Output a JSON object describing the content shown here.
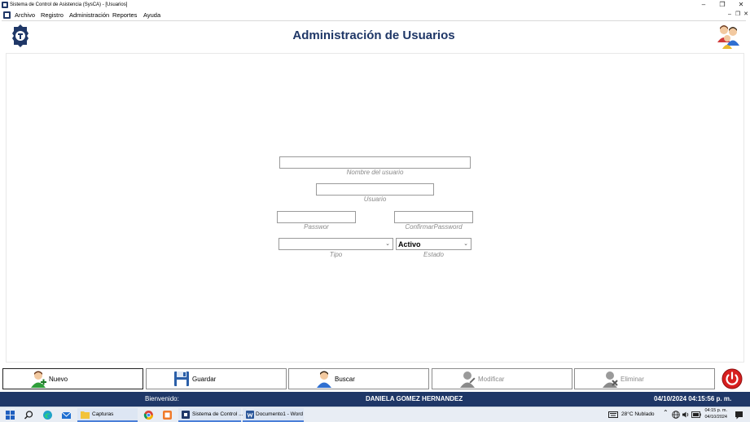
{
  "window": {
    "title": "Sistema de Control de Asistencia (SysCA) - [Usuarios]",
    "controls": {
      "minimize": "–",
      "restore": "❐",
      "close": "✕"
    },
    "mdi_controls": {
      "minimize": "–",
      "restore": "❐",
      "close": "✕"
    }
  },
  "menu": [
    "Archivo",
    "Registro",
    "Administración",
    "Reportes",
    "Ayuda"
  ],
  "header": {
    "title": "Administración de Usuarios"
  },
  "form": {
    "nombre": {
      "value": "",
      "caption": "Nombre del usuario"
    },
    "usuario": {
      "value": "",
      "caption": "Usuario"
    },
    "password": {
      "value": "",
      "caption": "Passwor"
    },
    "confirmar": {
      "value": "",
      "caption": "ConfirmarPassword"
    },
    "tipo": {
      "value": "",
      "caption": "Tipo"
    },
    "estado": {
      "value": "Activo",
      "caption": "Estado"
    }
  },
  "actions": [
    {
      "label": "Nuevo",
      "enabled": true,
      "active": true
    },
    {
      "label": "Guardar",
      "enabled": true
    },
    {
      "label": "Buscar",
      "enabled": true
    },
    {
      "label": "Modificar",
      "enabled": false
    },
    {
      "label": "Eliminar",
      "enabled": false
    }
  ],
  "status": {
    "welcome": "Bienvenido:",
    "user": "DANIELA GOMEZ HERNANDEZ",
    "datetime": "04/10/2024 04:15:56 p. m."
  },
  "taskbar": {
    "items": [
      "Capturas",
      "Sistema de Control ...",
      "Documento1 - Word"
    ],
    "weather": "28°C  Nublado",
    "clock_time": "04:15 p. m.",
    "clock_date": "04/10/2024"
  },
  "colors": {
    "brand": "#1f3767",
    "accent": "#4a7fd8",
    "power": "#d71f1f"
  }
}
